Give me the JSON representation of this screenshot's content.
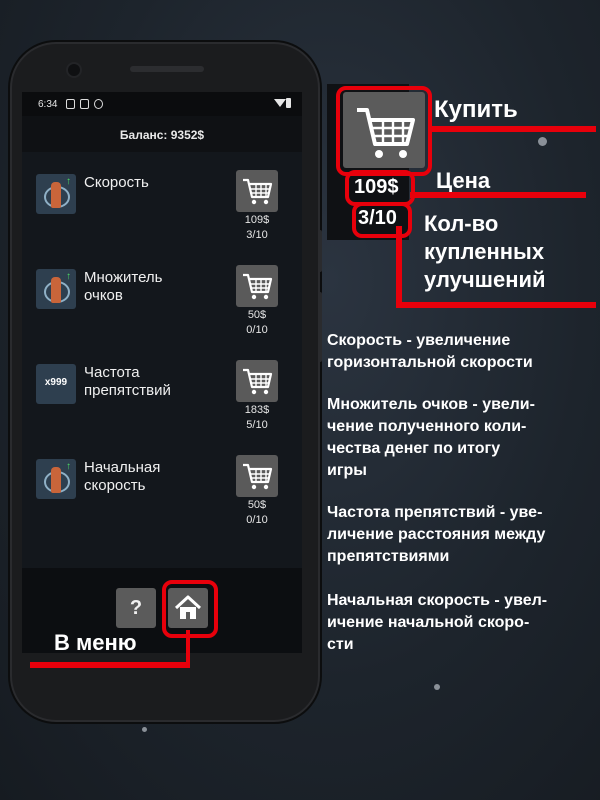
{
  "phone": {
    "status_time": "6:34",
    "balance": "Баланс: 9352$",
    "upgrades": [
      {
        "name": "Скорость",
        "icon": "speed-upgrade-icon",
        "price": "109$",
        "count": "3/10"
      },
      {
        "name": "Множитель\nочков",
        "icon": "score-multiplier-icon",
        "price": "50$",
        "count": "0/10"
      },
      {
        "name": "Частота\nпрепятствий",
        "icon": "obstacle-frequency-icon",
        "icon_text": "x999",
        "price": "183$",
        "count": "5/10"
      },
      {
        "name": "Начальная\nскорость",
        "icon": "start-speed-icon",
        "price": "50$",
        "count": "0/10"
      }
    ],
    "help_label": "?",
    "menu_icon": "home-icon"
  },
  "annotations": {
    "buy": "Купить",
    "price_label": "Цена",
    "price_example": "109$",
    "count_example": "3/10",
    "count_label": "Кол-во\nкупленных\nулучшений",
    "menu": "В меню"
  },
  "descriptions": [
    "Скорость - увеличение\nгоризонтальной скорости",
    "Множитель очков -  увели-\nчение полученного коли-\nчества денег по итогу\nигры",
    "Частота препятствий - уве-\nличение расстояния между\nпрепятствиями",
    "Начальная скорость - увел-\nичение начальной скоро-\nсти"
  ],
  "colors": {
    "accent": "#e8000b",
    "button": "#5b5b5b",
    "background": "#1d242c"
  }
}
